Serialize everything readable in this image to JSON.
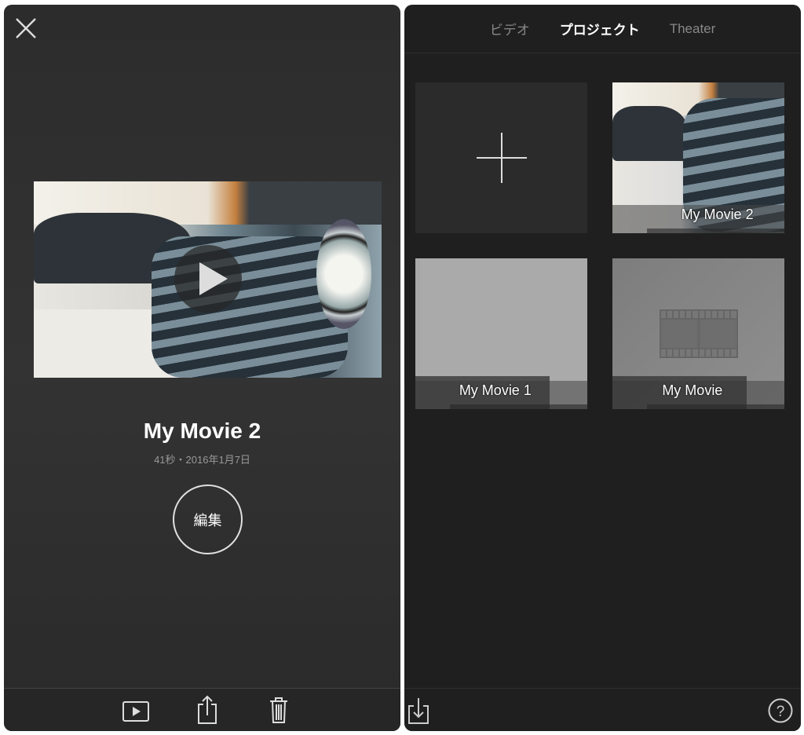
{
  "colors": {
    "panel_bg": "#2f2f2f",
    "grid_bg": "#1f1f1f",
    "accent": "#ffffff",
    "muted": "#999999"
  },
  "detail": {
    "close_icon": "close-icon",
    "title": "My Movie 2",
    "subtitle": "41秒・2016年1月7日",
    "edit_label": "編集",
    "toolbar": [
      "play-icon",
      "share-icon",
      "trash-icon"
    ]
  },
  "projects": {
    "tabs": [
      {
        "label": "ビデオ",
        "active": false
      },
      {
        "label": "プロジェクト",
        "active": true
      },
      {
        "label": "Theater",
        "active": false
      }
    ],
    "new_project_icon": "plus-icon",
    "items": [
      {
        "title": "My Movie 2"
      },
      {
        "title": "My Movie 1"
      },
      {
        "title": "My Movie"
      }
    ],
    "footer": [
      "import-icon",
      "help-icon"
    ]
  }
}
